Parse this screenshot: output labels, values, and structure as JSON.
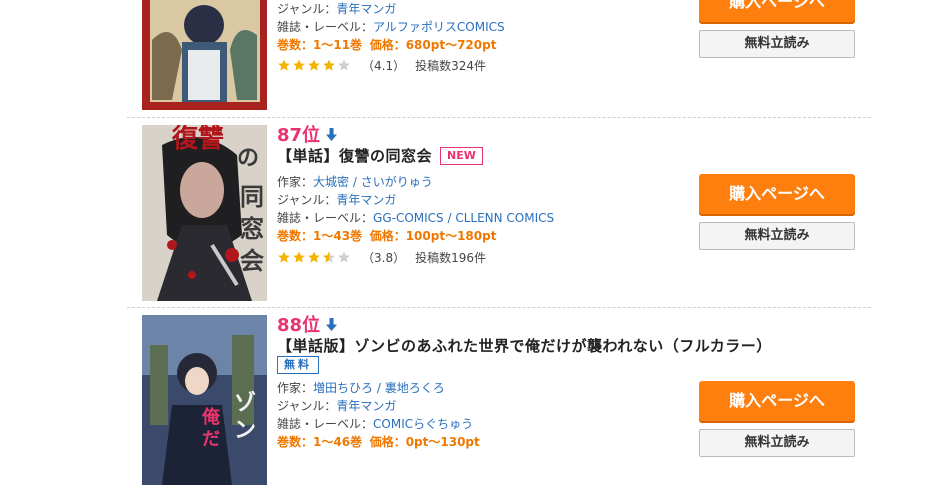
{
  "colors": {
    "rank": "#e8336d",
    "link": "#2a6fbd",
    "volume": "#ee7800",
    "buy_button": "#ff7f0e",
    "star": "#f5b301"
  },
  "items": [
    {
      "rank": "",
      "title": "",
      "genre_label": "ジャンル：",
      "genre": "青年マンガ",
      "label_label": "雑誌・レーベル：",
      "label": "アルファポリスCOMICS",
      "volumes": "巻数：1〜11巻",
      "price": "価格：680pt〜720pt",
      "rating": 4.1,
      "rating_text": "（4.1）",
      "review_count": "投稿数324件",
      "buy_label": "購入ページへ",
      "free_label": "無料立読み"
    },
    {
      "rank": "87位",
      "trend_icon": "arrow-down-icon",
      "title": "【単話】復讐の同窓会",
      "badge": "NEW",
      "author_label": "作家：",
      "author1": "大城密",
      "author_sep": " / ",
      "author2": "さいがりゅう",
      "genre_label": "ジャンル：",
      "genre": "青年マンガ",
      "label_label": "雑誌・レーベル：",
      "label1": "GG-COMICS",
      "label_sep": " / ",
      "label2": "CLLENN COMICS",
      "volumes": "巻数：1〜43巻",
      "price": "価格：100pt〜180pt",
      "rating": 3.8,
      "rating_text": "（3.8）",
      "review_count": "投稿数196件",
      "buy_label": "購入ページへ",
      "free_label": "無料立読み"
    },
    {
      "rank": "88位",
      "trend_icon": "arrow-down-icon",
      "title": "【単話版】ゾンビのあふれた世界で俺だけが襲われない（フルカラー）",
      "badge": "無料",
      "author_label": "作家：",
      "author1": "増田ちひろ",
      "author_sep": " / ",
      "author2": "裏地ろくろ",
      "genre_label": "ジャンル：",
      "genre": "青年マンガ",
      "label_label": "雑誌・レーベル：",
      "label": "COMICらぐちゅう",
      "volumes": "巻数：1〜46巻",
      "price": "価格：0pt〜130pt",
      "buy_label": "購入ページへ",
      "free_label": "無料立読み"
    }
  ]
}
